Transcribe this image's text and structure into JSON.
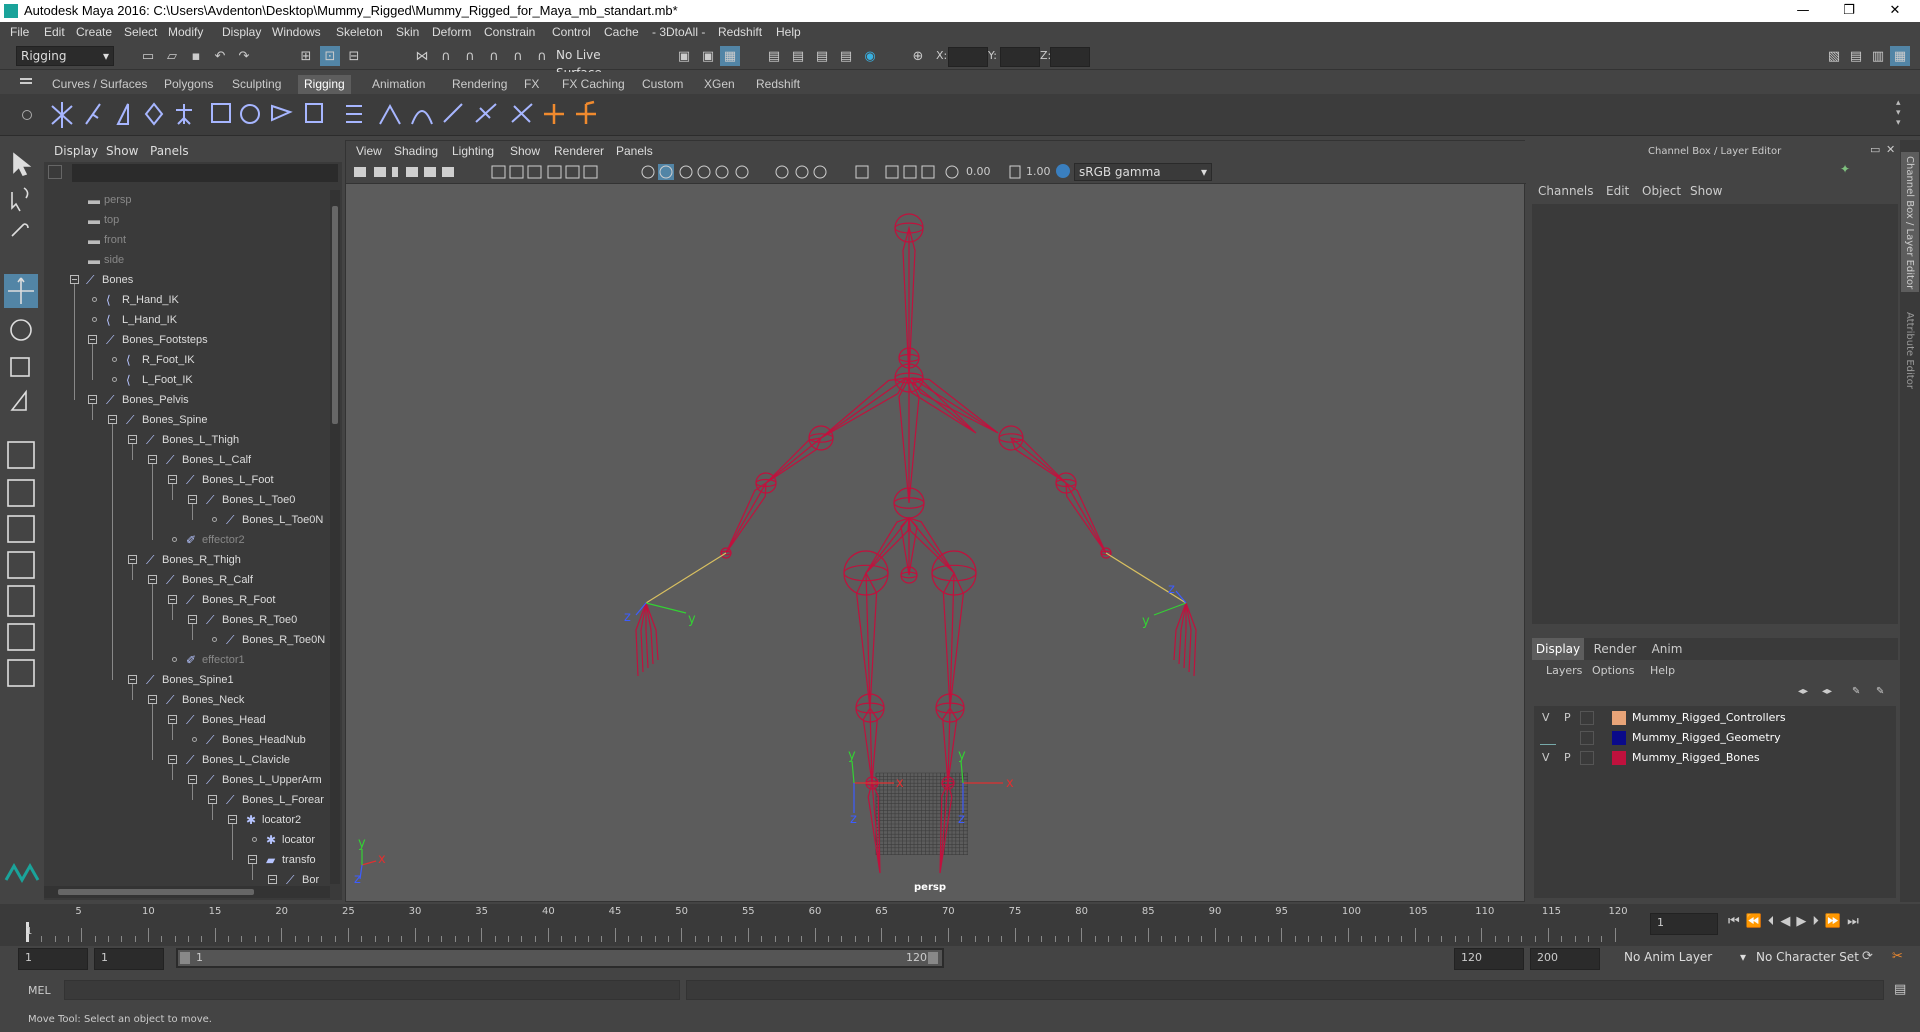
{
  "window": {
    "title": "Autodesk Maya 2016: C:\\Users\\Avdenton\\Desktop\\Mummy_Rigged\\Mummy_Rigged_for_Maya_mb_standart.mb*",
    "minimize": "—",
    "maximize": "❐",
    "close": "✕"
  },
  "menubar": [
    "File",
    "Edit",
    "Create",
    "Select",
    "Modify",
    "Display",
    "Windows",
    "Skeleton",
    "Skin",
    "Deform",
    "Constrain",
    "Control",
    "Cache",
    "- 3DtoAll -",
    "Redshift",
    "Help"
  ],
  "statusline": {
    "menuset": "Rigging",
    "live_surface": "No Live Surface",
    "x_label": "X:",
    "y_label": "Y:",
    "z_label": "Z:"
  },
  "shelf": {
    "tabs": [
      "Curves / Surfaces",
      "Polygons",
      "Sculpting",
      "Rigging",
      "Animation",
      "Rendering",
      "FX",
      "FX Caching",
      "Custom",
      "XGen",
      "Redshift"
    ],
    "active": "Rigging"
  },
  "outliner": {
    "menus": [
      "Display",
      "Show",
      "Panels"
    ],
    "rows": [
      {
        "label": "persp",
        "indent": 0,
        "dim": true,
        "type": "camera"
      },
      {
        "label": "top",
        "indent": 0,
        "dim": true,
        "type": "camera"
      },
      {
        "label": "front",
        "indent": 0,
        "dim": true,
        "type": "camera"
      },
      {
        "label": "side",
        "indent": 0,
        "dim": true,
        "type": "camera"
      },
      {
        "label": "Bones",
        "indent": 0,
        "exp": true,
        "type": "joint"
      },
      {
        "label": "R_Hand_IK",
        "indent": 1,
        "type": "ik"
      },
      {
        "label": "L_Hand_IK",
        "indent": 1,
        "type": "ik"
      },
      {
        "label": "Bones_Footsteps",
        "indent": 1,
        "exp": true,
        "type": "joint"
      },
      {
        "label": "R_Foot_IK",
        "indent": 2,
        "type": "ik"
      },
      {
        "label": "L_Foot_IK",
        "indent": 2,
        "type": "ik"
      },
      {
        "label": "Bones_Pelvis",
        "indent": 1,
        "exp": true,
        "type": "joint"
      },
      {
        "label": "Bones_Spine",
        "indent": 2,
        "exp": true,
        "type": "joint"
      },
      {
        "label": "Bones_L_Thigh",
        "indent": 3,
        "exp": true,
        "type": "joint"
      },
      {
        "label": "Bones_L_Calf",
        "indent": 4,
        "exp": true,
        "type": "joint"
      },
      {
        "label": "Bones_L_Foot",
        "indent": 5,
        "exp": true,
        "type": "joint"
      },
      {
        "label": "Bones_L_Toe0",
        "indent": 6,
        "exp": true,
        "type": "joint"
      },
      {
        "label": "Bones_L_Toe0N",
        "indent": 7,
        "type": "joint"
      },
      {
        "label": "effector2",
        "indent": 5,
        "dim": true,
        "type": "effector"
      },
      {
        "label": "Bones_R_Thigh",
        "indent": 3,
        "exp": true,
        "type": "joint"
      },
      {
        "label": "Bones_R_Calf",
        "indent": 4,
        "exp": true,
        "type": "joint"
      },
      {
        "label": "Bones_R_Foot",
        "indent": 5,
        "exp": true,
        "type": "joint"
      },
      {
        "label": "Bones_R_Toe0",
        "indent": 6,
        "exp": true,
        "type": "joint"
      },
      {
        "label": "Bones_R_Toe0N",
        "indent": 7,
        "type": "joint"
      },
      {
        "label": "effector1",
        "indent": 5,
        "dim": true,
        "type": "effector"
      },
      {
        "label": "Bones_Spine1",
        "indent": 3,
        "exp": true,
        "type": "joint"
      },
      {
        "label": "Bones_Neck",
        "indent": 4,
        "exp": true,
        "type": "joint"
      },
      {
        "label": "Bones_Head",
        "indent": 5,
        "exp": true,
        "type": "joint"
      },
      {
        "label": "Bones_HeadNub",
        "indent": 6,
        "type": "joint"
      },
      {
        "label": "Bones_L_Clavicle",
        "indent": 5,
        "exp": true,
        "type": "joint"
      },
      {
        "label": "Bones_L_UpperArm",
        "indent": 6,
        "exp": true,
        "type": "joint"
      },
      {
        "label": "Bones_L_Forear",
        "indent": 7,
        "exp": true,
        "type": "joint"
      },
      {
        "label": "locator2",
        "indent": 8,
        "exp": true,
        "type": "locator"
      },
      {
        "label": "locator",
        "indent": 9,
        "type": "locator"
      },
      {
        "label": "transfo",
        "indent": 9,
        "exp": true,
        "type": "transform"
      },
      {
        "label": "Bor",
        "indent": 10,
        "exp": true,
        "type": "joint"
      }
    ]
  },
  "viewport": {
    "menus": [
      "View",
      "Shading",
      "Lighting",
      "Show",
      "Renderer",
      "Panels"
    ],
    "near_value": "0.00",
    "far_value": "1.00",
    "colorspace": "sRGB gamma",
    "camera_label": "persp",
    "bone_color": "#c0113d",
    "axis_labels": {
      "x": "x",
      "y": "y",
      "z": "z"
    }
  },
  "channelbox": {
    "title": "Channel Box / Layer Editor",
    "menus": [
      "Channels",
      "Edit",
      "Object",
      "Show"
    ],
    "layer_tabs": [
      "Display",
      "Render",
      "Anim"
    ],
    "active_tab": "Display",
    "layer_menus": [
      "Layers",
      "Options",
      "Help"
    ],
    "layers": [
      {
        "v": "V",
        "p": "P",
        "name": "Mummy_Rigged_Controllers",
        "color": "#e8a478"
      },
      {
        "v": "",
        "p": "",
        "name": "Mummy_Rigged_Geometry",
        "color": "#0a0a8a"
      },
      {
        "v": "V",
        "p": "P",
        "name": "Mummy_Rigged_Bones",
        "color": "#c0113d"
      }
    ],
    "side_tabs": [
      "Channel Box / Layer Editor",
      "Attribute Editor"
    ]
  },
  "timeline": {
    "ticks": [
      5,
      10,
      15,
      20,
      25,
      30,
      35,
      40,
      45,
      50,
      55,
      60,
      65,
      70,
      75,
      80,
      85,
      90,
      95,
      100,
      105,
      110,
      115,
      120
    ],
    "current_frame": "1",
    "frame_field": "1"
  },
  "range": {
    "start": "1",
    "playback_start": "1",
    "slider_start": "1",
    "slider_end": "120",
    "playback_end": "120",
    "end": "200",
    "anim_layer": "No Anim Layer",
    "char_set": "No Character Set"
  },
  "commandline": {
    "label": "MEL"
  },
  "helpline": {
    "text": "Move Tool: Select an object to move."
  }
}
